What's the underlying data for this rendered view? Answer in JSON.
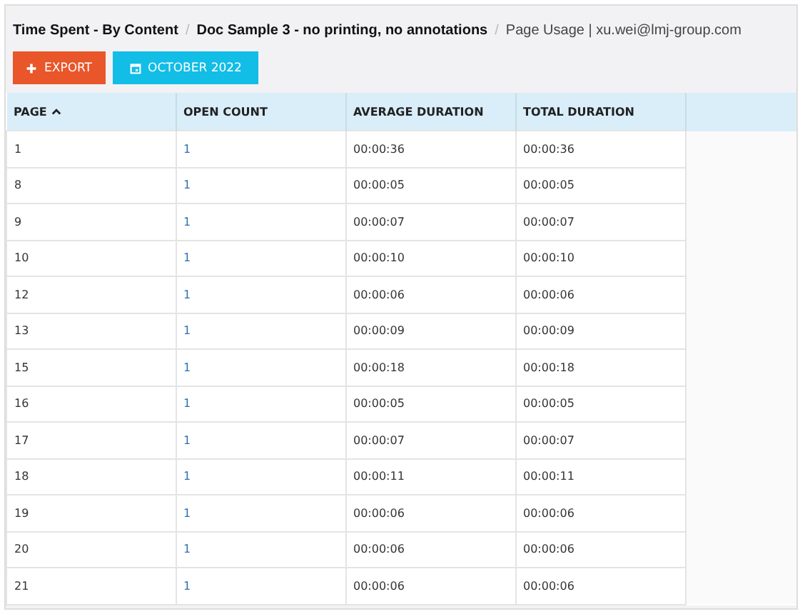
{
  "breadcrumbs": [
    {
      "label": "Time Spent - By Content",
      "kind": "strong"
    },
    {
      "label": "Doc Sample 3 - no printing, no annotations",
      "kind": "strong"
    },
    {
      "label": "Page Usage | xu.wei@lmj-group.com",
      "kind": "plain"
    }
  ],
  "separator": "/",
  "buttons": [
    {
      "label": "EXPORT",
      "kind": "export"
    },
    {
      "label": "OCTOBER 2022",
      "kind": "date"
    }
  ],
  "table": {
    "columns": [
      {
        "label": "PAGE",
        "sorted": true
      },
      {
        "label": "OPEN COUNT",
        "sorted": false
      },
      {
        "label": "AVERAGE DURATION",
        "sorted": false
      },
      {
        "label": "TOTAL DURATION",
        "sorted": false
      }
    ],
    "rows": [
      [
        "1",
        "1",
        "00:00:36",
        "00:00:36"
      ],
      [
        "8",
        "1",
        "00:00:05",
        "00:00:05"
      ],
      [
        "9",
        "1",
        "00:00:07",
        "00:00:07"
      ],
      [
        "10",
        "1",
        "00:00:10",
        "00:00:10"
      ],
      [
        "12",
        "1",
        "00:00:06",
        "00:00:06"
      ],
      [
        "13",
        "1",
        "00:00:09",
        "00:00:09"
      ],
      [
        "15",
        "1",
        "00:00:18",
        "00:00:18"
      ],
      [
        "16",
        "1",
        "00:00:05",
        "00:00:05"
      ],
      [
        "17",
        "1",
        "00:00:07",
        "00:00:07"
      ],
      [
        "18",
        "1",
        "00:00:11",
        "00:00:11"
      ],
      [
        "19",
        "1",
        "00:00:06",
        "00:00:06"
      ],
      [
        "20",
        "1",
        "00:00:06",
        "00:00:06"
      ],
      [
        "21",
        "1",
        "00:00:06",
        "00:00:06"
      ]
    ]
  }
}
